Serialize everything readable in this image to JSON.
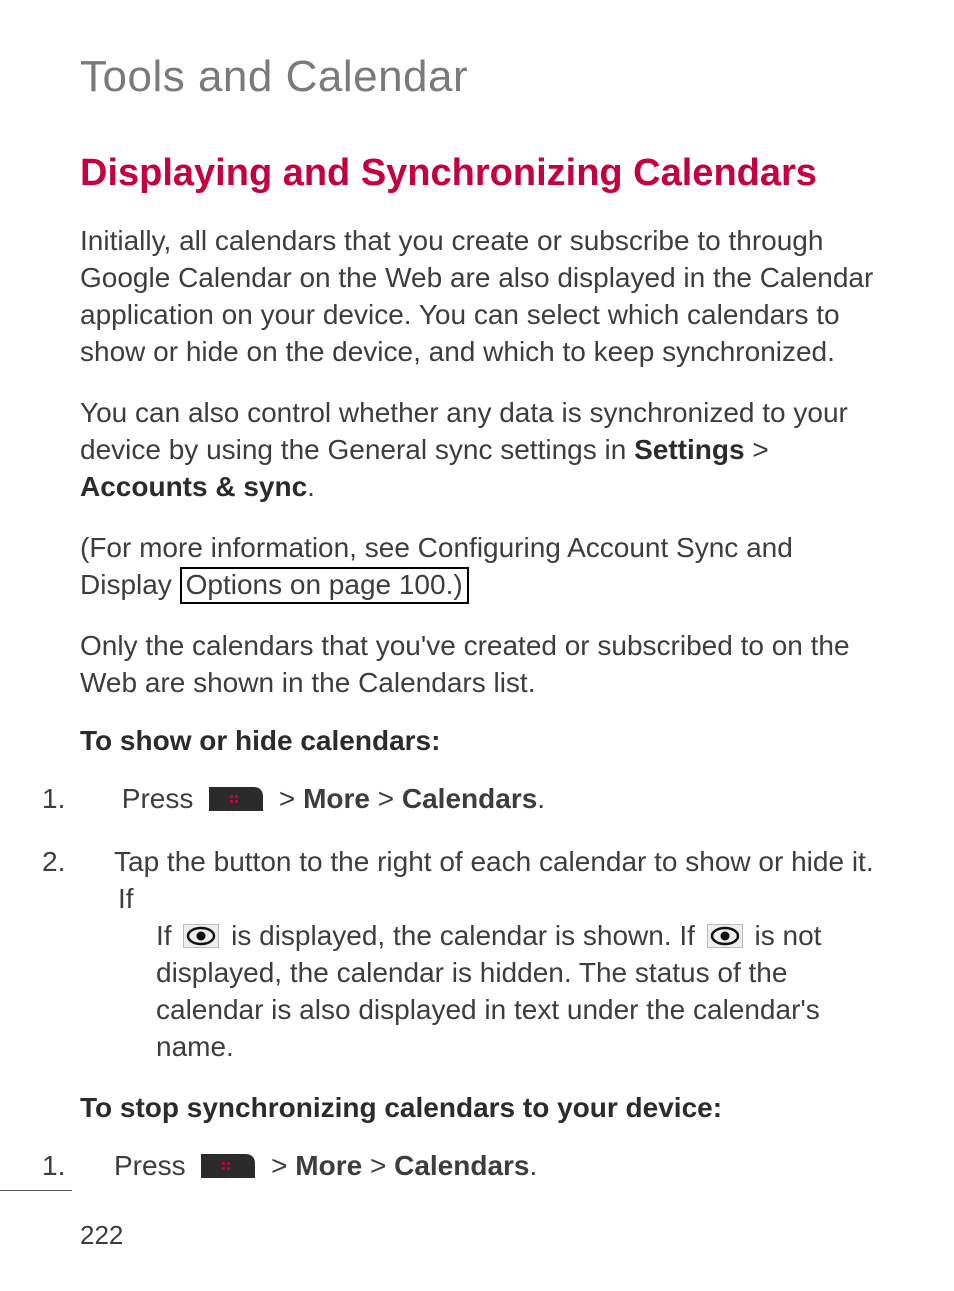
{
  "chapter_title": "Tools and Calendar",
  "section_heading": "Displaying and Synchronizing Calendars",
  "para1": "Initially, all calendars that you create or subscribe to through Google Calendar on the Web are also displayed in the Calendar application on your device. You can select which calendars to show or hide on the device, and which to keep synchronized.",
  "para2_pre": "You can also control whether any data is synchronized to your device by using the General sync settings in ",
  "para2_bold1": "Settings",
  "para2_sep1": " > ",
  "para2_bold2": "Accounts & sync",
  "para2_post": ".",
  "para3_pre": "(For more information, see Configuring Account Sync and Display ",
  "para3_linked": "Options on page 100.)",
  "para4": "Only the calendars that you've created or subscribed to on the Web are shown in the Calendars list.",
  "subheading1": "To show or hide calendars:",
  "s1_steps": {
    "step1_num": "1.",
    "step1_a": " Press ",
    "step1_b": " > ",
    "step1_more": "More",
    "step1_sep": " > ",
    "step1_cal": "Calendars",
    "step1_end": ".",
    "step2_num": "2.",
    "step2_a": "Tap the button to the right of each calendar to show or hide it. If ",
    "step2_b": " is displayed, the calendar is shown. If ",
    "step2_c": " is not displayed, the calendar is hidden. The status of the calendar is also displayed in text under the calendar's name."
  },
  "subheading2": "To stop synchronizing calendars to your device:",
  "s2_steps": {
    "step1_num": "1.",
    "step1_a": "Press ",
    "step1_b": " > ",
    "step1_more": "More",
    "step1_sep": " > ",
    "step1_cal": "Calendars",
    "step1_end": "."
  },
  "page_number": "222"
}
